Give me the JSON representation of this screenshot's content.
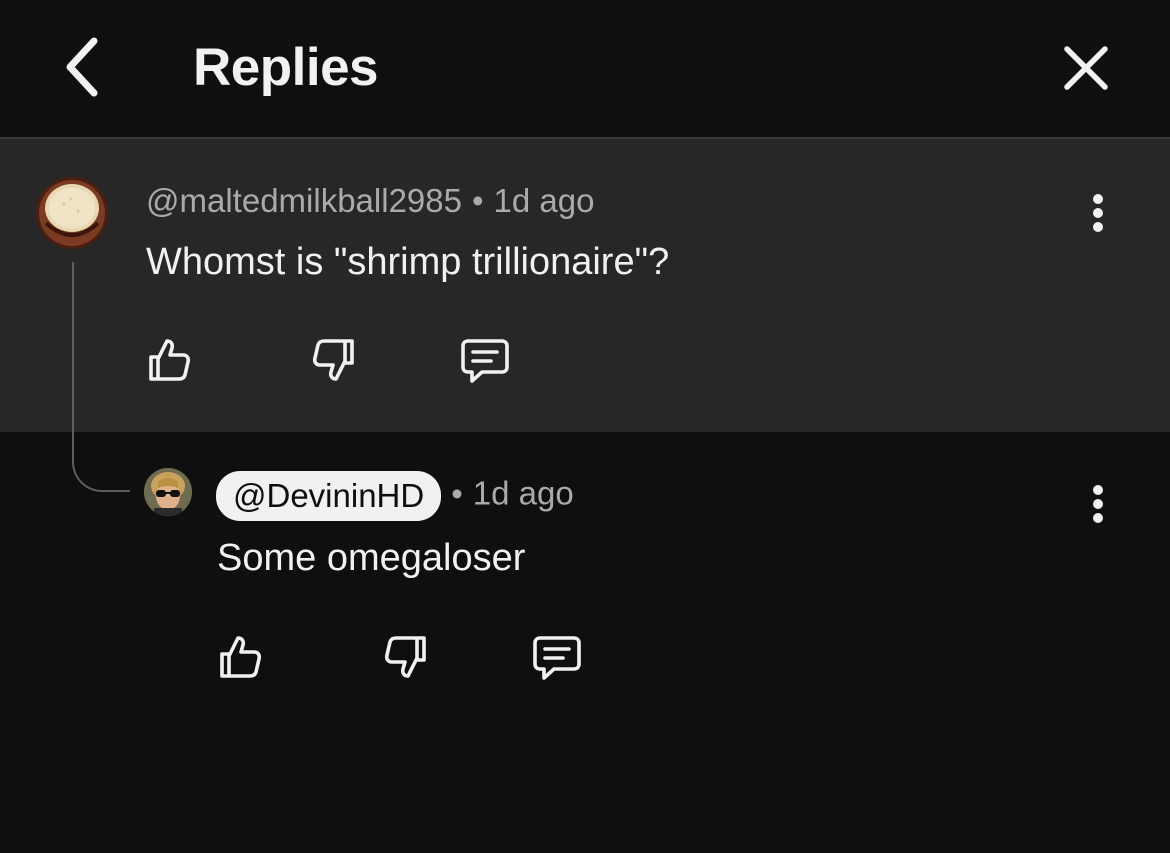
{
  "header": {
    "title": "Replies",
    "back_icon": "chevron-left-icon",
    "close_icon": "close-icon"
  },
  "parent_comment": {
    "handle": "@maltedmilkball2985",
    "separator": "•",
    "time": "1d ago",
    "text": "Whomst is \"shrimp trillionaire\"?",
    "actions": [
      "like-icon",
      "dislike-icon",
      "reply-icon"
    ],
    "more_icon": "more-vert-icon"
  },
  "reply": {
    "handle": "@DevininHD",
    "separator": "•",
    "time": "1d ago",
    "text": "Some omegaloser",
    "actions": [
      "like-icon",
      "dislike-icon",
      "reply-icon"
    ],
    "more_icon": "more-vert-icon"
  },
  "colors": {
    "background": "#0f0f0f",
    "parent_background": "#272727",
    "text_primary": "#f1f1f1",
    "text_secondary": "#aaaaaa",
    "handle_chip": "#f1f1f1"
  }
}
